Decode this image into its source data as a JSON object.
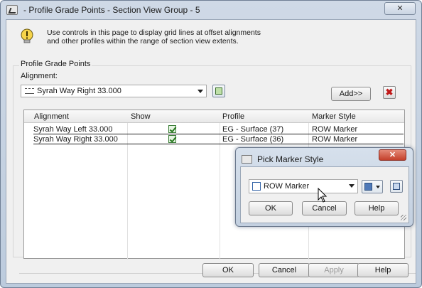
{
  "window": {
    "title": "- Profile Grade Points - Section View Group - 5",
    "close_label": "✕"
  },
  "info": {
    "text": "Use controls in this page to display grid lines at offset alignments and other profiles within the range of section view extents."
  },
  "group": {
    "label": "Profile Grade Points",
    "alignment_label": "Alignment:",
    "alignment_value": "Syrah Way  Right 33.000",
    "add_label": "Add>>",
    "delete_label": "✖"
  },
  "table": {
    "columns": [
      "Alignment",
      "Show",
      "Profile",
      "Marker Style"
    ],
    "rows": [
      {
        "alignment": "Syrah Way   Left 33.000",
        "show": true,
        "profile": "EG - Surface (37)",
        "marker": "ROW Marker"
      },
      {
        "alignment": "Syrah Way   Right 33.000",
        "show": true,
        "profile": "EG - Surface (36)",
        "marker": "ROW Marker"
      }
    ]
  },
  "footer": {
    "ok": "OK",
    "cancel": "Cancel",
    "apply": "Apply",
    "help": "Help"
  },
  "popup": {
    "title": "Pick Marker Style",
    "close_label": "✕",
    "select_value": "ROW Marker",
    "ok": "OK",
    "cancel": "Cancel",
    "help": "Help"
  }
}
